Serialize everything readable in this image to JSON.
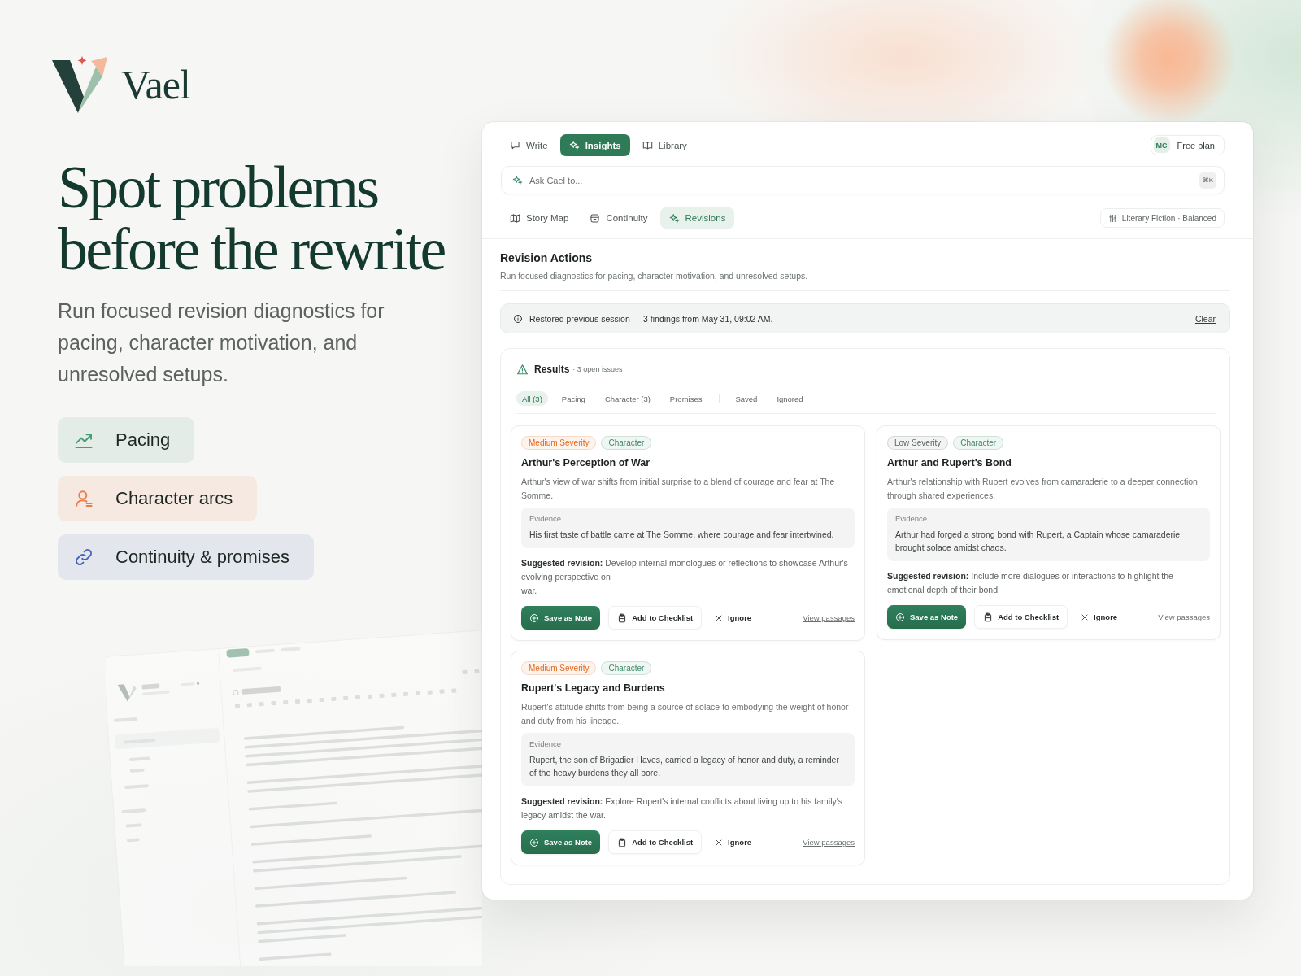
{
  "brand": {
    "name": "Vael"
  },
  "hero": {
    "headline": "Spot problems before the rewrite",
    "subtext": "Run focused revision diagnostics for pacing, character motivation, and unresolved setups."
  },
  "features": [
    {
      "label": "Pacing",
      "color": "#4b9a78"
    },
    {
      "label": "Character arcs",
      "color": "#ee7b4c"
    },
    {
      "label": "Continuity & promises",
      "color": "#4a63b8"
    }
  ],
  "app": {
    "nav_tabs": [
      {
        "label": "Write",
        "selected": false
      },
      {
        "label": "Insights",
        "selected": true
      },
      {
        "label": "Library",
        "selected": false
      }
    ],
    "account": {
      "initials": "MC",
      "plan": "Free plan"
    },
    "ask_bar": {
      "placeholder": "Ask Cael to...",
      "shortcut": "⌘K"
    },
    "view_tabs": [
      {
        "label": "Story Map",
        "selected": false
      },
      {
        "label": "Continuity",
        "selected": false
      },
      {
        "label": "Revisions",
        "selected": true
      }
    ],
    "preset": "Literary Fiction · Balanced",
    "section": {
      "title": "Revision Actions",
      "description": "Run focused diagnostics for pacing, character motivation, and unresolved setups."
    },
    "notice": {
      "text": "Restored previous session — 3 findings from May 31, 09:02 AM.",
      "action": "Clear"
    },
    "results": {
      "title": "Results",
      "count": "· 3 open issues",
      "filter_groups": [
        {
          "filters": [
            {
              "label": "All (3)",
              "selected": true
            },
            {
              "label": "Pacing",
              "selected": false
            },
            {
              "label": "Character (3)",
              "selected": false
            },
            {
              "label": "Promises",
              "selected": false
            }
          ]
        },
        {
          "filters": [
            {
              "label": "Saved",
              "selected": false
            },
            {
              "label": "Ignored",
              "selected": false
            }
          ]
        }
      ],
      "cards": [
        {
          "tags": [
            {
              "label": "Medium Severity",
              "color": "#e4691f"
            },
            {
              "label": "Character",
              "color": "#3f8a68"
            }
          ],
          "title": "Arthur's Perception of War",
          "description": "Arthur's view of war shifts from initial surprise to a blend of courage and fear at The Somme.",
          "evidence_label": "Evidence",
          "evidence": "His first taste of battle came at The Somme, where courage and fear intertwined.",
          "suggestion": "**Suggested revision:** Develop internal monologues or reflections to showcase Arthur's evolving perspective on\nwar.",
          "actions": [
            {
              "label": "Save as Note",
              "kind": "save"
            },
            {
              "label": "Add to Checklist",
              "kind": "checklist"
            },
            {
              "label": "Ignore",
              "kind": "ignore"
            },
            {
              "label": "View passages",
              "kind": "link"
            }
          ]
        },
        {
          "tags": [
            {
              "label": "Low Severity",
              "color": "#5f6664"
            },
            {
              "label": "Character",
              "color": "#3f8a68"
            }
          ],
          "title": "Arthur and Rupert's Bond",
          "description": "Arthur's relationship with Rupert evolves from camaraderie to a deeper connection through shared experiences.",
          "evidence_label": "Evidence",
          "evidence": "Arthur had forged a strong bond with Rupert, a Captain whose camaraderie brought solace amidst chaos.",
          "suggestion": "**Suggested revision:** Include more dialogues or interactions to highlight the emotional depth of their bond.",
          "actions": [
            {
              "label": "Save as Note",
              "kind": "save"
            },
            {
              "label": "Add to Checklist",
              "kind": "checklist"
            },
            {
              "label": "Ignore",
              "kind": "ignore"
            },
            {
              "label": "View passages",
              "kind": "link"
            }
          ]
        },
        {
          "tags": [
            {
              "label": "Medium Severity",
              "color": "#e4691f"
            },
            {
              "label": "Character",
              "color": "#3f8a68"
            }
          ],
          "title": "Rupert's Legacy and Burdens",
          "description": "Rupert's attitude shifts from being a source of solace to embodying the weight of honor and duty from his lineage.",
          "evidence_label": "Evidence",
          "evidence": "Rupert, the son of Brigadier Haves, carried a legacy of honor and duty, a reminder of the heavy burdens they all bore.",
          "suggestion": "**Suggested revision:** Explore Rupert's internal conflicts about living up to his family's legacy amidst the war.",
          "actions": [
            {
              "label": "Save as Note",
              "kind": "save"
            },
            {
              "label": "Add to Checklist",
              "kind": "checklist"
            },
            {
              "label": "Ignore",
              "kind": "ignore"
            },
            {
              "label": "View passages",
              "kind": "link"
            }
          ]
        }
      ]
    }
  }
}
